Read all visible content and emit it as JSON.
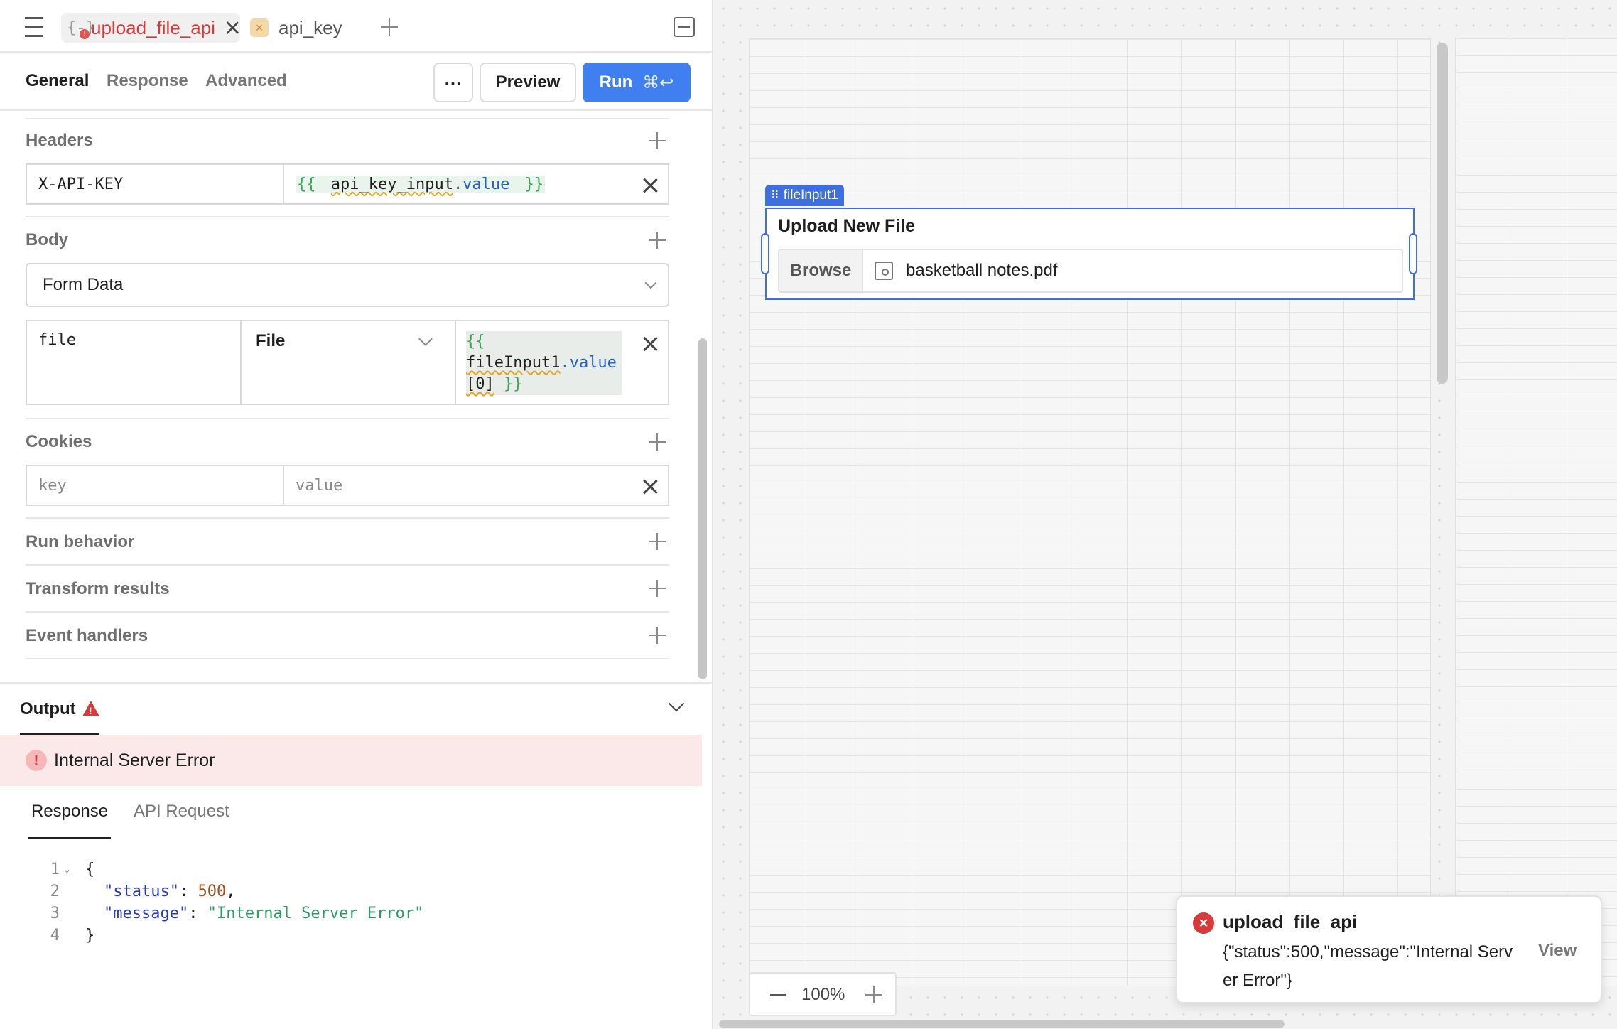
{
  "tabs": [
    {
      "label": "upload_file_api",
      "active": true,
      "has_error": true
    },
    {
      "label": "api_key",
      "active": false
    }
  ],
  "subnav": {
    "general": "General",
    "response": "Response",
    "advanced": "Advanced",
    "preview": "Preview",
    "run": "Run",
    "run_shortcut": "⌘↩"
  },
  "headers": {
    "title": "Headers",
    "key": "X-API-KEY",
    "value_open": "{{",
    "value_ref": "api_key_input",
    "value_prop": ".value",
    "value_close": "}}"
  },
  "body": {
    "title": "Body",
    "type": "Form Data",
    "row_key": "file",
    "row_type": "File",
    "value_open": "{{",
    "value_ref": "fileInput1",
    "value_prop": ".value",
    "value_index": "[0]",
    "value_close": "}}"
  },
  "cookies": {
    "title": "Cookies",
    "key_placeholder": "key",
    "value_placeholder": "value"
  },
  "sections": [
    "Run behavior",
    "Transform results",
    "Event handlers"
  ],
  "output": {
    "title": "Output",
    "error": "Internal Server Error",
    "tabs": [
      "Response",
      "API Request"
    ],
    "code": {
      "open": "{",
      "close": "}",
      "status_key": "\"status\"",
      "status_value": "500",
      "message_key": "\"message\"",
      "message_value": "\"Internal Server Error\""
    }
  },
  "canvas": {
    "widget_tag": "fileInput1",
    "widget_label": "Upload New File",
    "browse": "Browse",
    "filename": "basketball notes.pdf",
    "zoom": "100%"
  },
  "toast": {
    "title": "upload_file_api",
    "message": "{\"status\":500,\"message\":\"Internal Server Error\"}",
    "action": "View"
  },
  "colors": {
    "accent": "#3f7ff0",
    "error": "#d63a3a",
    "widget_outline": "#3f6fdc"
  }
}
